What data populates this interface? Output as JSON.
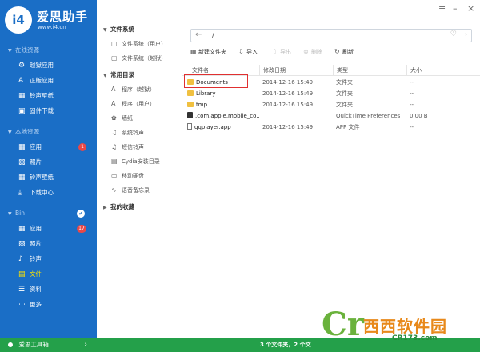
{
  "app": {
    "name": "爱思助手",
    "url": "www.i4.cn",
    "logo_glyph": "i4"
  },
  "colors": {
    "sidebar": "#1a6ec6",
    "statusbar": "#24a04a",
    "active_nav": "#ffe400",
    "badge": "#e84848",
    "highlight": "#e03030"
  },
  "window_controls": {
    "menu": "≡",
    "minimize": "–",
    "close": "×"
  },
  "sidebar": {
    "sections": [
      {
        "label": "在线资源",
        "items": [
          {
            "label": "越狱应用",
            "icon": "gear-icon",
            "glyph": "⚙"
          },
          {
            "label": "正版应用",
            "icon": "app-store-icon",
            "glyph": "A"
          },
          {
            "label": "铃声壁纸",
            "icon": "film-icon",
            "glyph": "▦"
          },
          {
            "label": "固件下载",
            "icon": "download-box-icon",
            "glyph": "▣"
          }
        ]
      },
      {
        "label": "本地资源",
        "items": [
          {
            "label": "应用",
            "icon": "apps-grid-icon",
            "glyph": "▦",
            "badge": "1"
          },
          {
            "label": "照片",
            "icon": "photo-icon",
            "glyph": "▨"
          },
          {
            "label": "铃声壁纸",
            "icon": "film-icon",
            "glyph": "▦"
          },
          {
            "label": "下载中心",
            "icon": "download-icon",
            "glyph": "⤓"
          }
        ]
      },
      {
        "label": "Bin",
        "checked": true,
        "items": [
          {
            "label": "应用",
            "icon": "apps-grid-icon",
            "glyph": "▦",
            "badge": "17"
          },
          {
            "label": "照片",
            "icon": "photo-icon",
            "glyph": "▨"
          },
          {
            "label": "铃声",
            "icon": "music-icon",
            "glyph": "♪"
          },
          {
            "label": "文件",
            "icon": "folder-icon",
            "glyph": "▤",
            "active": true
          },
          {
            "label": "资料",
            "icon": "list-icon",
            "glyph": "☰"
          },
          {
            "label": "更多",
            "icon": "more-icon",
            "glyph": "⋯"
          }
        ]
      }
    ],
    "footer": {
      "label": "爱思工具箱",
      "arrow": "›"
    }
  },
  "tree": {
    "groups": [
      {
        "label": "文件系统",
        "items": [
          {
            "label": "文件系统（用户）",
            "icon": "file-icon",
            "glyph": "▢"
          },
          {
            "label": "文件系统（越狱）",
            "icon": "file-icon",
            "glyph": "▢"
          }
        ]
      },
      {
        "label": "常用目录",
        "items": [
          {
            "label": "程序（越狱）",
            "icon": "app-icon",
            "glyph": "A"
          },
          {
            "label": "程序（用户）",
            "icon": "app-icon",
            "glyph": "A"
          },
          {
            "label": "墙纸",
            "icon": "flower-icon",
            "glyph": "✿"
          },
          {
            "label": "系统铃声",
            "icon": "bell-icon",
            "glyph": "♫"
          },
          {
            "label": "短信铃声",
            "icon": "bell-icon",
            "glyph": "♫"
          },
          {
            "label": "Cydia安装目录",
            "icon": "document-icon",
            "glyph": "▤"
          },
          {
            "label": "移动硬盘",
            "icon": "disk-icon",
            "glyph": "▭"
          },
          {
            "label": "语音备忘录",
            "icon": "mic-icon",
            "glyph": "∿"
          }
        ]
      },
      {
        "label": "我的收藏",
        "collapsed": true,
        "items": []
      }
    ]
  },
  "pathbar": {
    "back": "←",
    "path": "/",
    "favorite": "♡",
    "dropdown": "›"
  },
  "toolbar": {
    "new_folder": "新建文件夹",
    "import": "导入",
    "export": "导出",
    "delete": "删除",
    "refresh": "刷新"
  },
  "table": {
    "headers": {
      "name": "文件名",
      "date": "修改日期",
      "type": "类型",
      "size": "大小"
    },
    "rows": [
      {
        "name": "Documents",
        "date": "2014-12-16 15:49",
        "type": "文件夹",
        "size": "--",
        "icon": "folder"
      },
      {
        "name": "Library",
        "date": "2014-12-16 15:49",
        "type": "文件夹",
        "size": "--",
        "icon": "folder"
      },
      {
        "name": "tmp",
        "date": "2014-12-16 15:49",
        "type": "文件夹",
        "size": "--",
        "icon": "folder"
      },
      {
        "name": ".com.apple.mobile_co...",
        "date": "",
        "type": "QuickTime Preferences",
        "size": "0.00 B",
        "icon": "qt"
      },
      {
        "name": "qqplayer.app",
        "date": "2014-12-16 15:49",
        "type": "APP 文件",
        "size": "--",
        "icon": "file"
      }
    ]
  },
  "statusbar": {
    "text": "3 个文件夹，2 个文"
  },
  "watermark": {
    "mark": "Cr",
    "text": "西西软件园",
    "url": "CR173.com"
  }
}
